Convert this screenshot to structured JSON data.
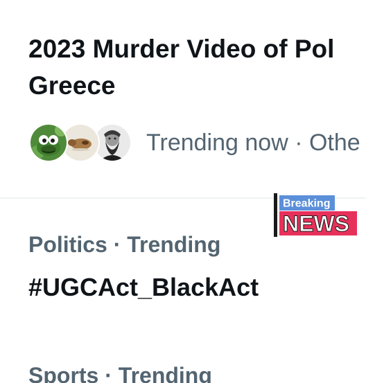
{
  "trend_1": {
    "title_line_1": "2023 Murder Video of Pol",
    "title_line_2": "Greece",
    "meta": "Trending now · Othe",
    "avatar_icons": [
      "frog-avatar-icon",
      "animal-avatar-icon",
      "bearded-man-avatar-icon"
    ]
  },
  "badge": {
    "top_text": "Breaking",
    "bottom_text": "NEWS",
    "colors": {
      "top": "#5b8fd9",
      "bottom": "#e8315a",
      "bar": "#1a1a1a"
    }
  },
  "trend_2": {
    "category": "Politics · Trending",
    "hashtag": "#UGCAct_BlackAct"
  },
  "trend_3": {
    "category": "Sports · Trending"
  },
  "colors": {
    "primary_text": "#0f1419",
    "secondary_text": "#536471",
    "divider": "#eff3f4"
  }
}
